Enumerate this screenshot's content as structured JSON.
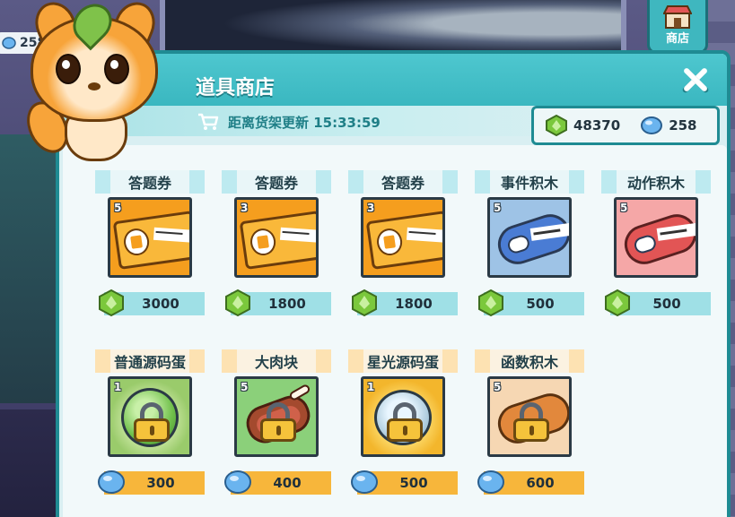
{
  "hud": {
    "top_left_currency": "258",
    "shop_button_label": "商店"
  },
  "dialog": {
    "title": "道具商店",
    "refresh_text": "距离货架更新 15:33:59",
    "wallet": {
      "green_gems": "48370",
      "blue_gems": "258"
    }
  },
  "items": [
    {
      "name": "答题券",
      "qty": "5",
      "price": "3000",
      "currency": "green-gem",
      "art": "ticket"
    },
    {
      "name": "答题券",
      "qty": "3",
      "price": "1800",
      "currency": "green-gem",
      "art": "ticket"
    },
    {
      "name": "答题券",
      "qty": "3",
      "price": "1800",
      "currency": "green-gem",
      "art": "ticket"
    },
    {
      "name": "事件积木",
      "qty": "5",
      "price": "500",
      "currency": "green-gem",
      "art": "event-key"
    },
    {
      "name": "动作积木",
      "qty": "5",
      "price": "500",
      "currency": "green-gem",
      "art": "motion-key"
    },
    {
      "name": "普通源码蛋",
      "qty": "1",
      "price": "300",
      "currency": "blue-gem",
      "art": "green-egg",
      "locked": true
    },
    {
      "name": "大肉块",
      "qty": "5",
      "price": "400",
      "currency": "blue-gem",
      "art": "meat",
      "locked": true
    },
    {
      "name": "星光源码蛋",
      "qty": "1",
      "price": "500",
      "currency": "blue-gem",
      "art": "star-egg",
      "locked": true
    },
    {
      "name": "函数积木",
      "qty": "5",
      "price": "600",
      "currency": "blue-gem",
      "art": "function-key",
      "locked": true
    }
  ],
  "colors": {
    "teal": "#3ab7c0",
    "green_gem": "#7bc83c",
    "blue_gem": "#6ab4ef",
    "egg_price_bar": "#f7b63b"
  }
}
